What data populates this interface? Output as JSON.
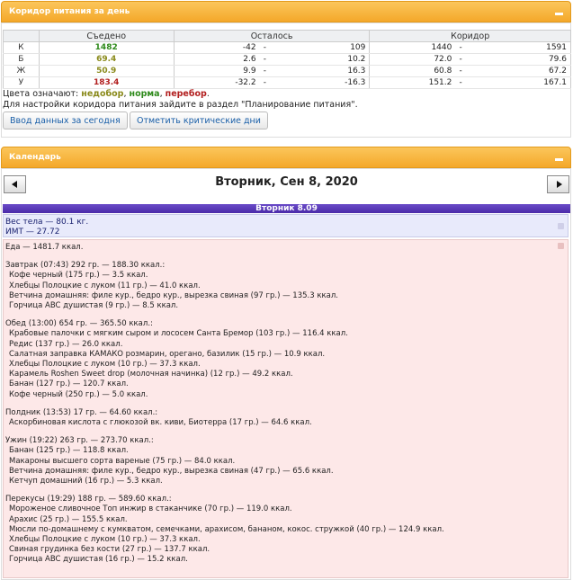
{
  "corridor_panel": {
    "title": "Коридор питания за день",
    "headers": {
      "eaten": "Съедено",
      "remaining": "Осталось",
      "corridor": "Коридор"
    },
    "rows": [
      {
        "label": "К",
        "eaten": "1482",
        "status": "ok",
        "rem_min": "-42",
        "rem_dash": "-",
        "rem_max": "109",
        "cor_min": "1440",
        "cor_dash": "-",
        "cor_max": "1591"
      },
      {
        "label": "Б",
        "eaten": "69.4",
        "status": "under",
        "rem_min": "2.6",
        "rem_dash": "-",
        "rem_max": "10.2",
        "cor_min": "72.0",
        "cor_dash": "-",
        "cor_max": "79.6"
      },
      {
        "label": "Ж",
        "eaten": "50.9",
        "status": "under",
        "rem_min": "9.9",
        "rem_dash": "-",
        "rem_max": "16.3",
        "cor_min": "60.8",
        "cor_dash": "-",
        "cor_max": "67.2"
      },
      {
        "label": "У",
        "eaten": "183.4",
        "status": "over",
        "rem_min": "-32.2",
        "rem_dash": "-",
        "rem_max": "-16.3",
        "cor_min": "151.2",
        "cor_dash": "-",
        "cor_max": "167.1"
      }
    ],
    "legend": {
      "prefix": "Цвета означают: ",
      "under": "недобор",
      "sep1": ", ",
      "ok": "норма",
      "sep2": ", ",
      "over": "перебор",
      "end": "."
    },
    "note": "Для настройки коридора питания зайдите в раздел \"Планирование питания\".",
    "buttons": {
      "input_today": "Ввод данных за сегодня",
      "mark_critical": "Отметить критические дни"
    }
  },
  "calendar_panel": {
    "title": "Календарь",
    "date": "Вторник, Сен 8, 2020",
    "day_bar": "Вторник 8.09",
    "weight": "Вес тела — 80.1 кг.",
    "bmi": "ИМТ — 27.72",
    "food_lines": [
      {
        "text": "Еда — 1481.7 ккал.",
        "item": false
      },
      {
        "text": "Завтрак (07:43) 292 гр. — 188.30 ккал.:",
        "item": false
      },
      {
        "text": "Кофе черный (175 гр.) — 3.5 ккал.",
        "item": true
      },
      {
        "text": "Хлебцы Полоцкие с луком (11 гр.) — 41.0 ккал.",
        "item": true
      },
      {
        "text": "Ветчина домашняя: филе кур., бедро кур., вырезка свиная (97 гр.) — 135.3 ккал.",
        "item": true
      },
      {
        "text": "Горчица ABC душистая (9 гр.) — 8.5 ккал.",
        "item": true
      },
      {
        "text": "Обед (13:00) 654 гр. — 365.50 ккал.:",
        "item": false
      },
      {
        "text": "Крабовые палочки с мягким сыром и лососем Санта Бремор (103 гр.) — 116.4 ккал.",
        "item": true
      },
      {
        "text": "Редис (137 гр.) — 26.0 ккал.",
        "item": true
      },
      {
        "text": "Салатная заправка КАМАКО розмарин, орегано, базилик (15 гр.) — 10.9 ккал.",
        "item": true
      },
      {
        "text": "Хлебцы Полоцкие с луком (10 гр.) — 37.3 ккал.",
        "item": true
      },
      {
        "text": "Карамель Roshen Sweet drop (молочная начинка) (12 гр.) — 49.2 ккал.",
        "item": true
      },
      {
        "text": "Банан (127 гр.) — 120.7 ккал.",
        "item": true
      },
      {
        "text": "Кофе черный (250 гр.) — 5.0 ккал.",
        "item": true
      },
      {
        "text": "Полдник (13:53) 17 гр. — 64.60 ккал.:",
        "item": false
      },
      {
        "text": "Аскорбиновая кислота с глюкозой вк. киви, Биотерра (17 гр.) — 64.6 ккал.",
        "item": true
      },
      {
        "text": "Ужин (19:22) 263 гр. — 273.70 ккал.:",
        "item": false
      },
      {
        "text": "Банан (125 гр.) — 118.8 ккал.",
        "item": true
      },
      {
        "text": "Макароны высшего сорта вареные (75 гр.) — 84.0 ккал.",
        "item": true
      },
      {
        "text": "Ветчина домашняя: филе кур., бедро кур., вырезка свиная (47 гр.) — 65.6 ккал.",
        "item": true
      },
      {
        "text": "Кетчуп домашний (16 гр.) — 5.3 ккал.",
        "item": true
      },
      {
        "text": "Перекусы (19:29) 188 гр. — 589.60 ккал.:",
        "item": false
      },
      {
        "text": "Мороженое сливочное Топ инжир в стаканчике (70 гр.) — 119.0 ккал.",
        "item": true
      },
      {
        "text": "Арахис (25 гр.) — 155.5 ккал.",
        "item": true
      },
      {
        "text": "Мюсли по-домашнему с кумкватом, семечками, арахисом, бананом, кокос. стружкой (40 гр.) — 124.9 ккал.",
        "item": true
      },
      {
        "text": "Хлебцы Полоцкие с луком (10 гр.) — 37.3 ккал.",
        "item": true
      },
      {
        "text": "Свиная грудинка без кости (27 гр.) — 137.7 ккал.",
        "item": true
      },
      {
        "text": "Горчица ABC душистая (16 гр.) — 15.2 ккал.",
        "item": true
      }
    ]
  },
  "colors": {
    "header_orange": "#f4a82a",
    "ok": "#2e8a1b",
    "under": "#8a8a1b",
    "over": "#b21f1f",
    "day_bar": "#5a3ab8",
    "food_bg": "#fde8e8"
  }
}
